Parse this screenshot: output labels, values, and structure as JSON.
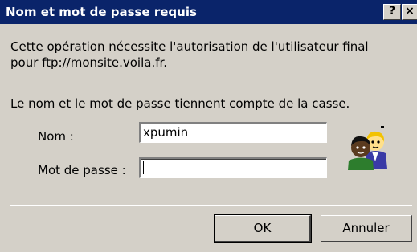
{
  "dialog": {
    "title": "Nom et mot de passe requis",
    "help_glyph": "?",
    "close_glyph": "×"
  },
  "message": {
    "line1": "Cette opération nécessite l'autorisation de l'utilisateur final",
    "line2": "pour ftp://monsite.voila.fr.",
    "case_note": "Le nom et le mot de passe tiennent compte de la casse."
  },
  "form": {
    "name_label": "Nom :",
    "name_value": "xpumin",
    "password_label": "Mot de passe :",
    "password_value": ""
  },
  "icons": {
    "user_icon": "users-icon"
  },
  "buttons": {
    "ok_label": "OK",
    "cancel_label": "Annuler"
  }
}
